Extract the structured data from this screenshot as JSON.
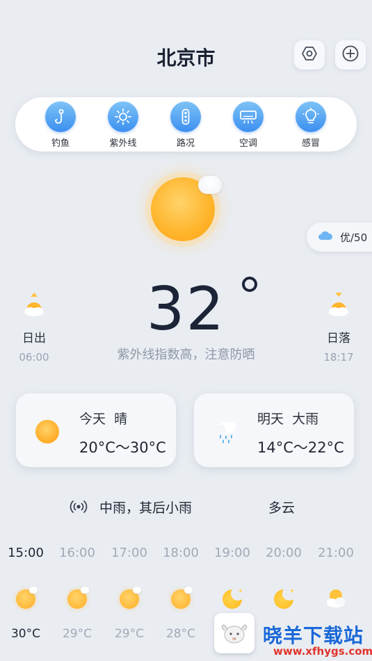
{
  "header": {
    "city": "北京市",
    "settings_icon": "hexagon-settings-icon",
    "add_icon": "plus-circle-icon"
  },
  "quick_items": [
    {
      "label": "钓鱼",
      "icon": "fishing-hook-icon"
    },
    {
      "label": "紫外线",
      "icon": "sun-uv-icon"
    },
    {
      "label": "路况",
      "icon": "traffic-light-icon"
    },
    {
      "label": "空调",
      "icon": "air-conditioner-icon"
    },
    {
      "label": "感冒",
      "icon": "lightbulb-cold-icon"
    }
  ],
  "aqi": {
    "text": "优/50"
  },
  "current": {
    "temperature": "32",
    "tip": "紫外线指数高，注意防晒"
  },
  "sunrise": {
    "label": "日出",
    "time": "06:00"
  },
  "sunset": {
    "label": "日落",
    "time": "18:17"
  },
  "forecast": {
    "today": {
      "day": "今天",
      "condition": "晴",
      "range": "20°C～30°C"
    },
    "tomorrow": {
      "day": "明天",
      "condition": "大雨",
      "range": "14°C～22°C"
    }
  },
  "hint": {
    "text": "中雨，其后小雨",
    "text2": "多云"
  },
  "hourly": [
    {
      "time": "15:00",
      "temp": "30°C",
      "icon": "sun"
    },
    {
      "time": "16:00",
      "temp": "29°C",
      "icon": "sun"
    },
    {
      "time": "17:00",
      "temp": "29°C",
      "icon": "sun"
    },
    {
      "time": "18:00",
      "temp": "28°C",
      "icon": "sun"
    },
    {
      "time": "19:00",
      "temp": "",
      "icon": "moon"
    },
    {
      "time": "20:00",
      "temp": "",
      "icon": "moon"
    },
    {
      "time": "21:00",
      "temp": "",
      "icon": "partly-cloudy"
    }
  ],
  "watermark": {
    "title": "晓羊下载站",
    "url": "www.xfhygs.com"
  },
  "colors": {
    "background": "#e9edf2",
    "accent_blue": "#3b8ff0",
    "sun_orange": "#ffae25",
    "watermark_blue": "#1a68d8",
    "watermark_red": "#e0332b"
  }
}
